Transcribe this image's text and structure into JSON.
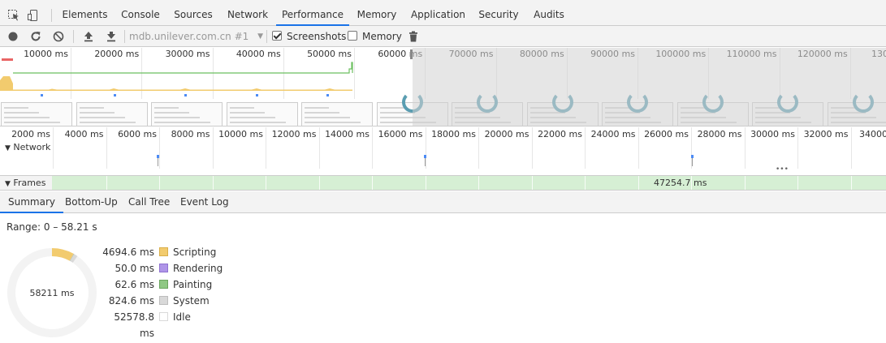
{
  "tabs": [
    {
      "label": "Elements"
    },
    {
      "label": "Console"
    },
    {
      "label": "Sources"
    },
    {
      "label": "Network"
    },
    {
      "label": "Performance",
      "active": true
    },
    {
      "label": "Memory"
    },
    {
      "label": "Application"
    },
    {
      "label": "Security"
    },
    {
      "label": "Audits"
    }
  ],
  "toolbar": {
    "profile_select": "mdb.unilever.com.cn #1",
    "screenshots_label": "Screenshots",
    "screenshots_checked": true,
    "memory_label": "Memory",
    "memory_checked": false
  },
  "overview": {
    "ticks": [
      "10000 ms",
      "20000 ms",
      "30000 ms",
      "40000 ms",
      "50000 ms",
      "60000 ms",
      "70000 ms",
      "80000 ms",
      "90000 ms",
      "100000 ms",
      "110000 ms",
      "120000 ms",
      "130"
    ]
  },
  "detail": {
    "ticks": [
      "2000 ms",
      "4000 ms",
      "6000 ms",
      "8000 ms",
      "10000 ms",
      "12000 ms",
      "14000 ms",
      "16000 ms",
      "18000 ms",
      "20000 ms",
      "22000 ms",
      "24000 ms",
      "26000 ms",
      "28000 ms",
      "30000 ms",
      "32000 ms",
      "34000"
    ],
    "network_label": "Network",
    "frames_label": "Frames",
    "frame_duration": "47254.7 ms"
  },
  "bottom_tabs": [
    {
      "label": "Summary",
      "active": true
    },
    {
      "label": "Bottom-Up"
    },
    {
      "label": "Call Tree"
    },
    {
      "label": "Event Log"
    }
  ],
  "summary": {
    "range": "Range: 0 – 58.21 s",
    "total": "58211 ms",
    "items": [
      {
        "value": "4694.6 ms",
        "ms": 4694.6,
        "name": "Scripting",
        "color": "#f2cb6e",
        "border": "#d9ae4a"
      },
      {
        "value": "50.0 ms",
        "ms": 50.0,
        "name": "Rendering",
        "color": "#af95e8",
        "border": "#8f72d0"
      },
      {
        "value": "62.6 ms",
        "ms": 62.6,
        "name": "Painting",
        "color": "#8fc884",
        "border": "#6aa55e"
      },
      {
        "value": "824.6 ms",
        "ms": 824.6,
        "name": "System",
        "color": "#d9d9d9",
        "border": "#bdbdbd"
      },
      {
        "value": "52578.8 ms",
        "ms": 52578.8,
        "name": "Idle",
        "color": "#ffffff",
        "border": "#d9d9d9"
      }
    ]
  }
}
